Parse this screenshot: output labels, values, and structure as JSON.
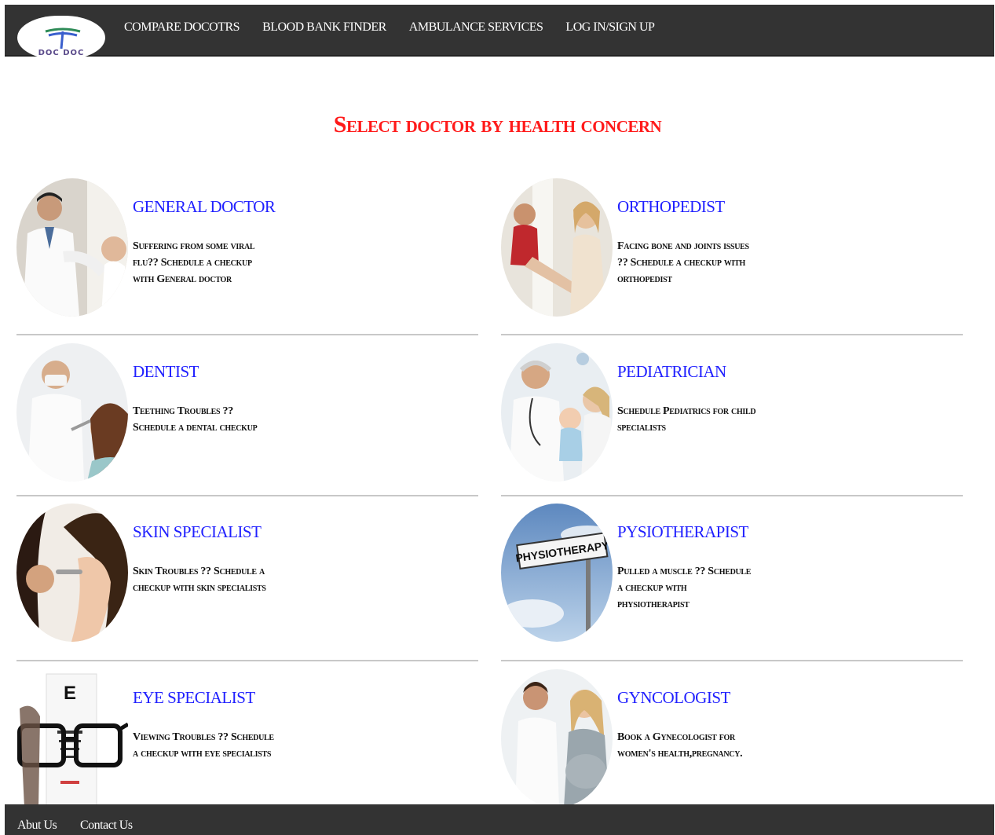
{
  "brand": {
    "logo_text": "DOC DOC"
  },
  "nav": [
    {
      "label": "COMPARE DOCOTRS"
    },
    {
      "label": "BLOOD BANK FINDER"
    },
    {
      "label": "AMBULANCE SERVICES"
    },
    {
      "label": "LOG IN/SIGN UP"
    }
  ],
  "heading": "Select doctor by health concern",
  "cards": [
    {
      "title": "GENERAL DOCTOR",
      "desc": "Suffering from some viral flu?? Schedule a checkup with General doctor"
    },
    {
      "title": "ORTHOPEDIST",
      "desc": "Facing bone and joints issues ?? Schedule a checkup with orthopedist"
    },
    {
      "title": "DENTIST",
      "desc": "Teething Troubles ?? Schedule a dental checkup"
    },
    {
      "title": "PEDIATRICIAN",
      "desc": "Schedule Pediatrics for child specialists"
    },
    {
      "title": "SKIN SPECIALIST",
      "desc": "Skin Troubles ?? Schedule a checkup with skin specialists"
    },
    {
      "title": "PYSIOTHERAPIST",
      "desc": "Pulled a muscle ?? Schedule a checkup with physiotherapist"
    },
    {
      "title": "EYE SPECIALIST",
      "desc": "Viewing Troubles ?? Schedule a checkup with eye specialists"
    },
    {
      "title": "GYNCOLOGIST",
      "desc": "Book a Gynecologist for women's health,pregnancy."
    }
  ],
  "photo_labels": {
    "physio_sign": "PHYSIOTHERAPY",
    "eye_chart_letter": "E"
  },
  "footer": [
    {
      "label": "Abut Us"
    },
    {
      "label": "Contact Us"
    }
  ]
}
